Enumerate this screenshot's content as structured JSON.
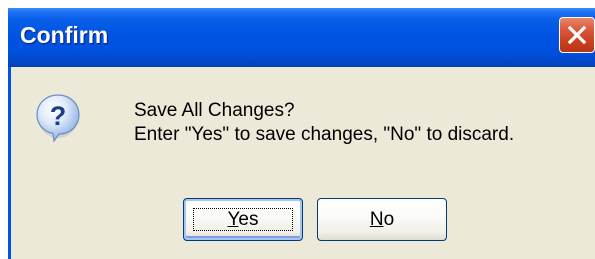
{
  "dialog": {
    "title": "Confirm",
    "icon": "question-icon",
    "message_line1": "Save All Changes?",
    "message_line2": "Enter \"Yes\" to save changes, \"No\" to discard.",
    "buttons": {
      "yes": {
        "mnemonic": "Y",
        "rest": "es"
      },
      "no": {
        "mnemonic": "N",
        "rest": "o"
      }
    },
    "default_button": "Yes"
  },
  "colors": {
    "titlebar": "#0054e3",
    "dialog_background": "#ece9d8",
    "close_button": "#d9583a"
  }
}
